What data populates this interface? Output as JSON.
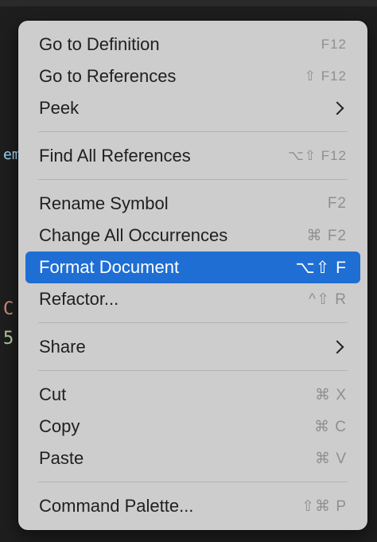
{
  "editor": {
    "fragment_1": "em",
    "fragment_2": "C",
    "fragment_3": "5"
  },
  "menu": {
    "groups": [
      [
        {
          "label": "Go to Definition",
          "shortcut": "F12"
        },
        {
          "label": "Go to References",
          "shortcut": "⇧ F12"
        },
        {
          "label": "Peek",
          "submenu": true
        }
      ],
      [
        {
          "label": "Find All References",
          "shortcut": "⌥⇧ F12"
        }
      ],
      [
        {
          "label": "Rename Symbol",
          "shortcut": "F2"
        },
        {
          "label": "Change All Occurrences",
          "shortcut": "⌘ F2"
        },
        {
          "label": "Format Document",
          "shortcut": "⌥⇧ F",
          "active": true
        },
        {
          "label": "Refactor...",
          "shortcut": "^⇧ R"
        }
      ],
      [
        {
          "label": "Share",
          "submenu": true
        }
      ],
      [
        {
          "label": "Cut",
          "shortcut": "⌘ X"
        },
        {
          "label": "Copy",
          "shortcut": "⌘ C"
        },
        {
          "label": "Paste",
          "shortcut": "⌘ V"
        }
      ],
      [
        {
          "label": "Command Palette...",
          "shortcut": "⇧⌘ P"
        }
      ]
    ],
    "colors": {
      "background": "#cdcdcd",
      "highlight": "#1f6ed4",
      "shortcut_text": "#8f8f8f"
    }
  }
}
